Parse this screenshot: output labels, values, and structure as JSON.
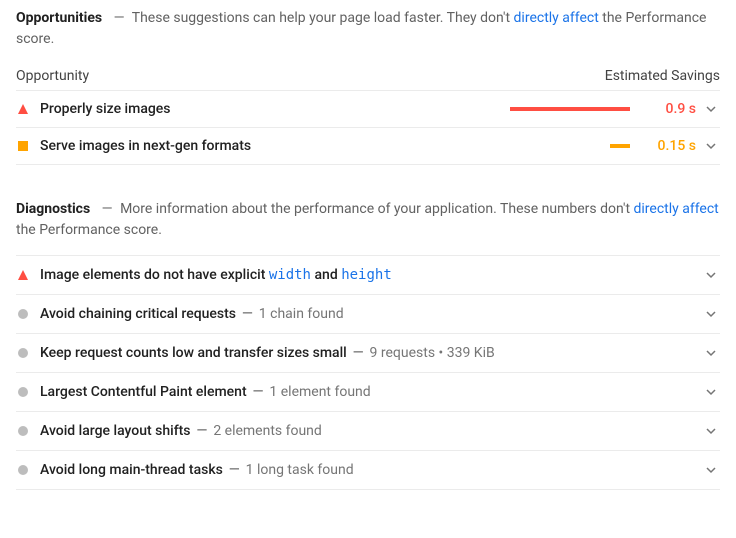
{
  "opportunities": {
    "title": "Opportunities",
    "sub_plain1": "These suggestions can help your page load faster. They don't ",
    "sub_link": "directly affect",
    "sub_plain2": " the Performance score.",
    "col_left": "Opportunity",
    "col_right": "Estimated Savings",
    "items": [
      {
        "mark": "red-triangle",
        "title": "Properly size images",
        "bar_pct": 100,
        "time": "0.9 s",
        "color": "#ff4e42"
      },
      {
        "mark": "orange-square",
        "title": "Serve images in next-gen formats",
        "bar_pct": 17,
        "time": "0.15 s",
        "color": "#ffa400"
      }
    ]
  },
  "diagnostics": {
    "title": "Diagnostics",
    "sub_plain1": "More information about the performance of your application. These numbers don't ",
    "sub_link": "directly affect",
    "sub_plain2": " the Performance score.",
    "items": [
      {
        "mark": "red-triangle",
        "title_pre": "Image elements do not have explicit ",
        "code1": "width",
        "title_mid": " and ",
        "code2": "height",
        "detail": ""
      },
      {
        "mark": "gray-circle",
        "title": "Avoid chaining critical requests",
        "detail": "1 chain found"
      },
      {
        "mark": "gray-circle",
        "title": "Keep request counts low and transfer sizes small",
        "detail": "9 requests • 339 KiB"
      },
      {
        "mark": "gray-circle",
        "title": "Largest Contentful Paint element",
        "detail": "1 element found"
      },
      {
        "mark": "gray-circle",
        "title": "Avoid large layout shifts",
        "detail": "2 elements found"
      },
      {
        "mark": "gray-circle",
        "title": "Avoid long main-thread tasks",
        "detail": "1 long task found"
      }
    ]
  },
  "dash": "—"
}
